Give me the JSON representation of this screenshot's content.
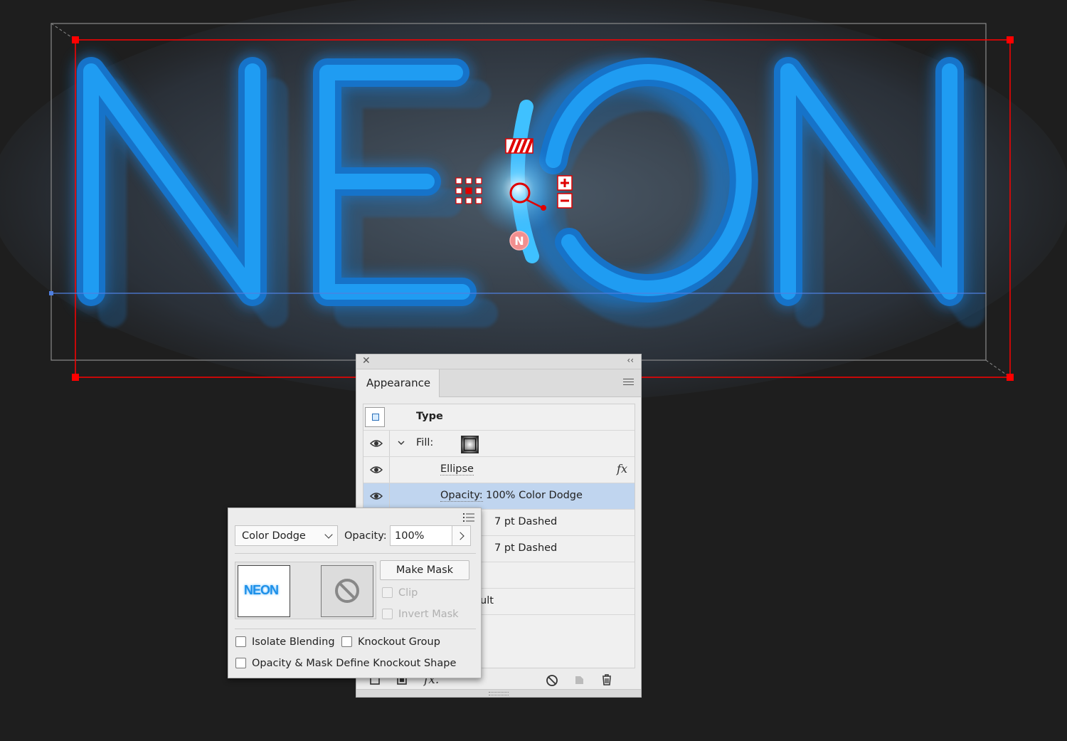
{
  "canvas": {
    "artwork_text": "NEON",
    "gradient_annotator_label": "N"
  },
  "appearance_panel": {
    "tab_label": "Appearance",
    "rows": {
      "type_label": "Type",
      "fill_label": "Fill:",
      "ellipse_label": "Ellipse",
      "fx_label": "fx",
      "opacity_label": "Opacity:",
      "opacity_value": "100% Color Dodge",
      "stroke1_value": "7 pt Dashed",
      "stroke2_value": "7 pt Dashed",
      "default_partial": "ult"
    }
  },
  "transparency_flyout": {
    "blend_mode": "Color Dodge",
    "opacity_label": "Opacity:",
    "opacity_value": "100%",
    "thumbnail_text": "NEON",
    "make_mask_label": "Make Mask",
    "clip_label": "Clip",
    "invert_mask_label": "Invert Mask",
    "isolate_blending_label": "Isolate Blending",
    "knockout_group_label": "Knockout Group",
    "knockout_shape_label": "Opacity & Mask Define Knockout Shape",
    "isolate_blending_checked": false,
    "knockout_group_checked": false,
    "knockout_shape_checked": false
  },
  "colors": {
    "background": "#1e1e1e",
    "neon_blue": "#1e90e8",
    "selection_red": "#ff0000",
    "baseline_blue": "#4f7fe0",
    "selected_row": "#c0d5ef"
  }
}
